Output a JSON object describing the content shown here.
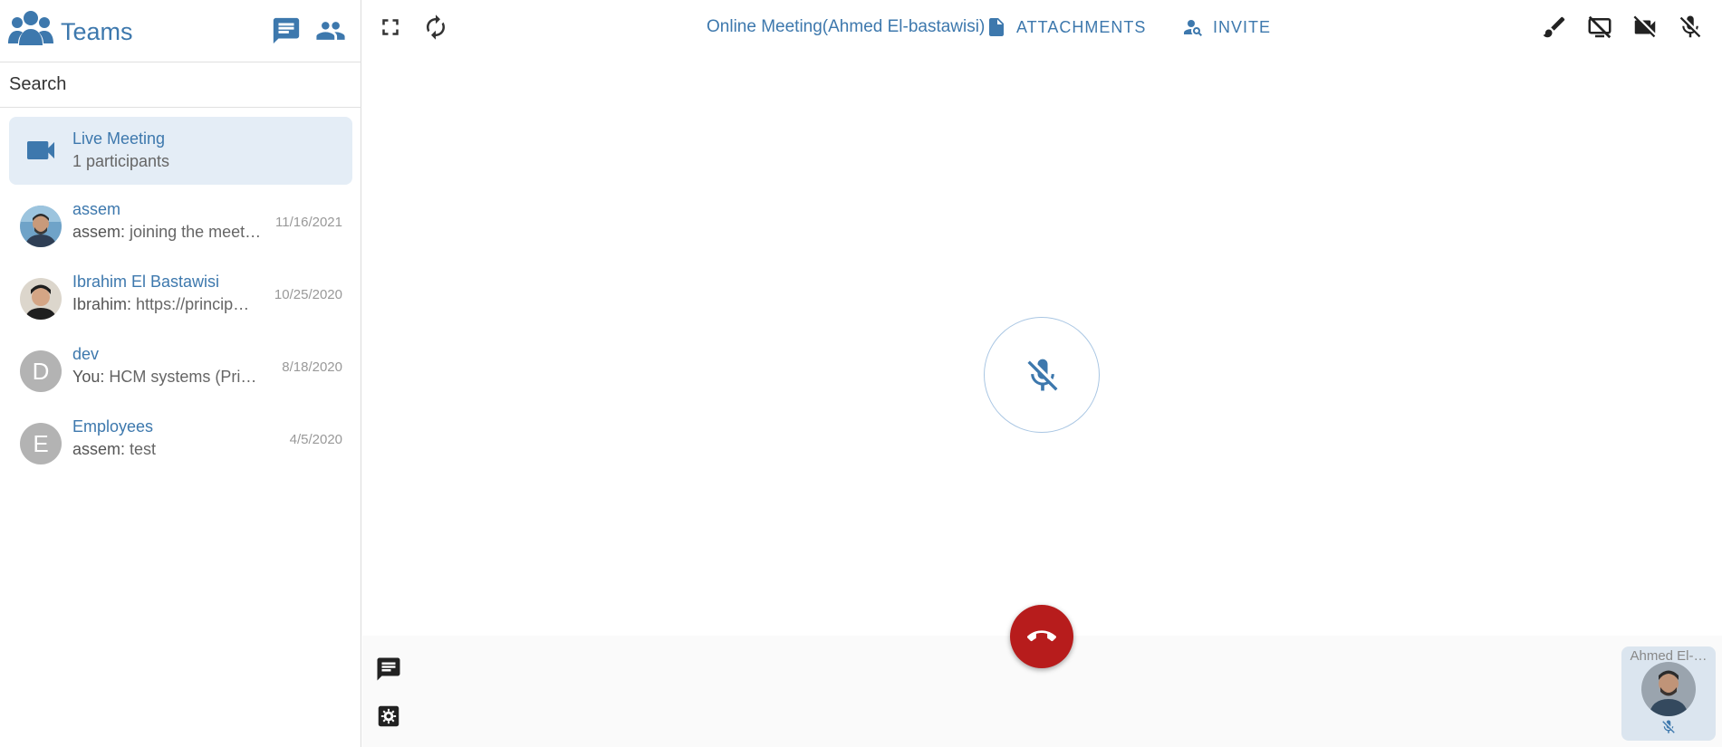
{
  "app": {
    "title": "Teams"
  },
  "sidebar": {
    "search": {
      "placeholder": "Search"
    },
    "live_meeting": {
      "name": "Live Meeting",
      "subtitle": "1 participants"
    },
    "conversations": [
      {
        "name": "assem",
        "sender": "assem:",
        "preview": "joining the meet…",
        "date": "11/16/2021",
        "avatar": "photo"
      },
      {
        "name": "Ibrahim El Bastawisi",
        "sender": "Ibrahim:",
        "preview": "https://princip…",
        "date": "10/25/2020",
        "avatar": "photo"
      },
      {
        "name": "dev",
        "sender": "You:",
        "preview": "HCM systems (Prin…",
        "date": "8/18/2020",
        "avatar": "D"
      },
      {
        "name": "Employees",
        "sender": "assem:",
        "preview": "test",
        "date": "4/5/2020",
        "avatar": "E"
      }
    ]
  },
  "meeting": {
    "title": "Online Meeting(Ahmed El-bastawisi)",
    "attachments_label": "ATTACHMENTS",
    "invite_label": "INVITE",
    "participant_name": "Ahmed El-…"
  },
  "colors": {
    "accent": "#3d78ad",
    "hangup": "#b71c1c",
    "selected_bg": "#e4edf6"
  },
  "icons": [
    "group-icon",
    "chat-icon",
    "people-icon",
    "videocam-icon",
    "fullscreen-icon",
    "refresh-icon",
    "document-icon",
    "person-search-icon",
    "brush-icon",
    "screen-share-off-icon",
    "video-off-icon",
    "mic-off-icon",
    "call-end-icon",
    "list-icon",
    "settings-icon"
  ]
}
